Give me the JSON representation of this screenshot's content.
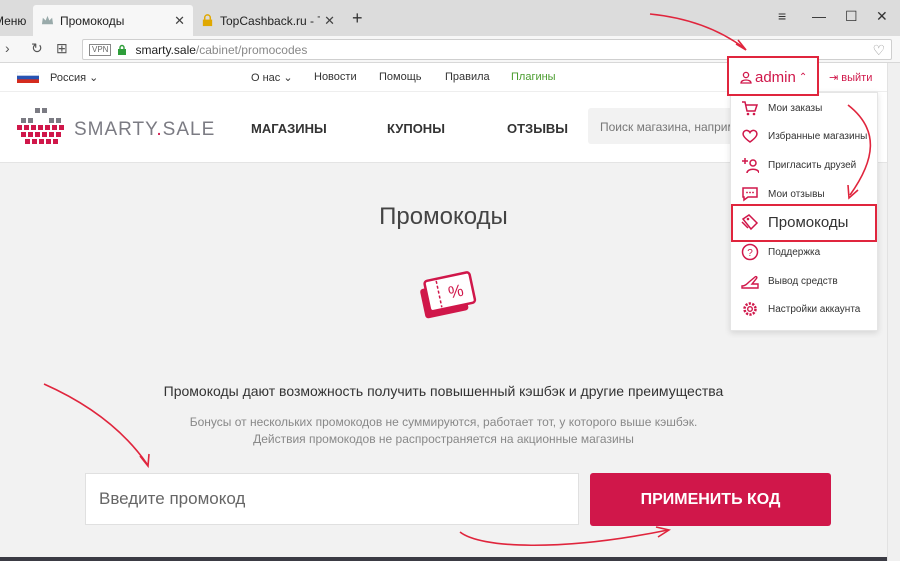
{
  "browser": {
    "menu_label": "Меню",
    "tabs": [
      {
        "title": "Промокоды",
        "active": true
      },
      {
        "title": "TopCashback.ru - Топ лучш",
        "active": false
      }
    ],
    "url_host": "smarty.sale",
    "url_path": "/cabinet/promocodes",
    "vpn_label": "VPN"
  },
  "site": {
    "top_nav": {
      "region": "Россия",
      "items": [
        "О нас",
        "Новости",
        "Помощь",
        "Правила",
        "Плагины"
      ],
      "user": "admin",
      "logout": "выйти"
    },
    "logo": {
      "part1": "SMARTY",
      "dot": ".",
      "part2": "SALE"
    },
    "main_menu": [
      "МАГАЗИНЫ",
      "КУПОНЫ",
      "ОТЗЫВЫ"
    ],
    "search_placeholder": "Поиск магазина, например",
    "page_title": "Промокоды",
    "lead": "Промокоды дают возможность получить повышенный кэшбэк и другие преимущества",
    "notes": [
      "Бонусы от нескольких промокодов не суммируются, работает тот, у которого выше кэшбэк.",
      "Действия промокодов не распространяется на акционные магазины"
    ],
    "promo_input_placeholder": "Введите промокод",
    "apply_button": "ПРИМЕНИТЬ КОД",
    "dropdown": [
      {
        "label": "Мои заказы",
        "icon": "cart-icon"
      },
      {
        "label": "Избранные магазины",
        "icon": "heart-icon"
      },
      {
        "label": "Пригласить друзей",
        "icon": "add-user-icon"
      },
      {
        "label": "Мои отзывы",
        "icon": "chat-icon"
      },
      {
        "label": "Промокоды",
        "icon": "tags-icon"
      },
      {
        "label": "Поддержка",
        "icon": "help-icon"
      },
      {
        "label": "Вывод средств",
        "icon": "withdraw-icon"
      },
      {
        "label": "Настройки аккаунта",
        "icon": "gear-icon"
      }
    ]
  },
  "colors": {
    "brand": "#d0174a",
    "annotation": "#e0253d",
    "green": "#4a9c2e"
  }
}
